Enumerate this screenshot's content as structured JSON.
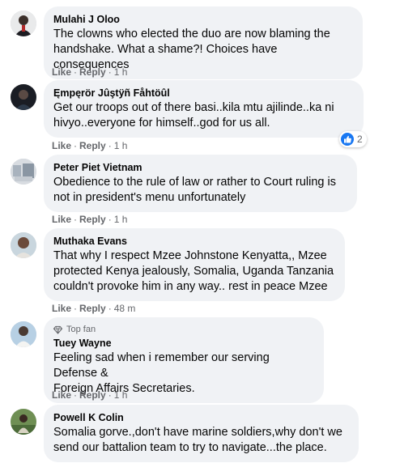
{
  "actions": {
    "like": "Like",
    "reply": "Reply",
    "separator": "·"
  },
  "colors": {
    "bubble": "#f0f2f5",
    "meta": "#65676b",
    "like_blue": "#1877f2"
  },
  "comments": [
    {
      "author": "Mulahi J Oloo",
      "text": "The clowns who elected the duo are now blaming the\nhandshake. What a shame?! Choices have consequences",
      "time": "1 h"
    },
    {
      "author": "Ęmpęrör Jûştÿñ Fåhtöûl",
      "text": "Get our troops out of there basi..kila mtu ajilinde..ka ni\nhivyo..everyone for himself..god for us all.",
      "time": "1 h",
      "reaction_icon": "like-icon",
      "reaction_count": "2"
    },
    {
      "author": "Peter Piet Vietnam",
      "text": "Obedience to the rule of law or rather to Court ruling is\nnot in president's menu unfortunately",
      "time": "1 h"
    },
    {
      "author": "Muthaka Evans",
      "text": "That why I respect Mzee Johnstone Kenyatta,, Mzee\nprotected Kenya jealously, Somalia, Uganda Tanzania\ncouldn't provoke him in any way.. rest in peace Mzee",
      "time": "48 m"
    },
    {
      "badge": "Top fan",
      "author": "Tuey Wayne",
      "text": "Feeling sad when i remember our serving Defense &\nForeign Affairs Secretaries.",
      "time": "1 h"
    },
    {
      "author": "Powell K Colin",
      "text": "Somalia gorve.,don't have marine soldiers,why don't we\nsend our battalion team to try to navigate...the place."
    }
  ]
}
